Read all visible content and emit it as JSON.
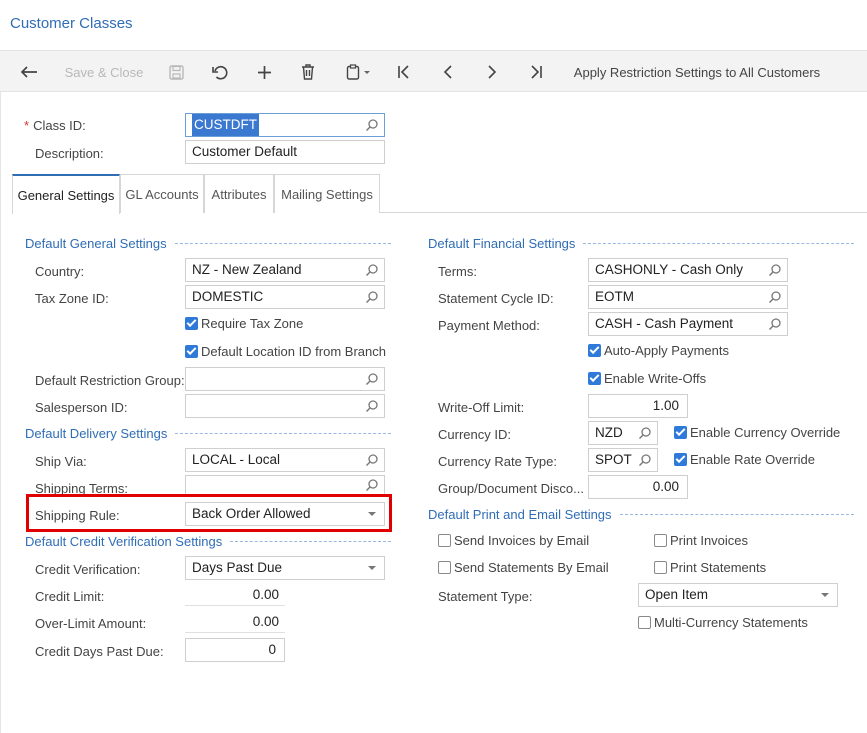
{
  "page": {
    "title": "Customer Classes"
  },
  "toolbar": {
    "save_close": "Save & Close",
    "apply_restriction": "Apply Restriction Settings to All Customers",
    "icons": [
      "back-arrow-icon",
      "save-icon",
      "undo-icon",
      "plus-icon",
      "trash-icon",
      "clipboard-icon",
      "first-icon",
      "prev-icon",
      "next-icon",
      "last-icon"
    ]
  },
  "header": {
    "class_id_label": "Class ID:",
    "class_id_value": "CUSTDFT",
    "description_label": "Description:",
    "description_value": "Customer Default"
  },
  "tabs": [
    {
      "label": "General Settings",
      "active": true
    },
    {
      "label": "GL Accounts"
    },
    {
      "label": "Attributes"
    },
    {
      "label": "Mailing Settings"
    }
  ],
  "general": {
    "section_title": "Default General Settings",
    "country_label": "Country:",
    "country_value": "NZ - New Zealand",
    "tax_zone_label": "Tax Zone ID:",
    "tax_zone_value": "DOMESTIC",
    "require_tax_zone": {
      "label": "Require Tax Zone",
      "checked": true
    },
    "default_location": {
      "label": "Default Location ID from Branch",
      "checked": true
    },
    "restriction_group_label": "Default Restriction Group:",
    "restriction_group_value": "",
    "salesperson_label": "Salesperson ID:",
    "salesperson_value": ""
  },
  "delivery": {
    "section_title": "Default Delivery Settings",
    "ship_via_label": "Ship Via:",
    "ship_via_value": "LOCAL - Local",
    "shipping_terms_label": "Shipping Terms:",
    "shipping_terms_value": "",
    "shipping_rule_label": "Shipping Rule:",
    "shipping_rule_value": "Back Order Allowed"
  },
  "credit": {
    "section_title": "Default Credit Verification Settings",
    "verification_label": "Credit Verification:",
    "verification_value": "Days Past Due",
    "limit_label": "Credit Limit:",
    "limit_value": "0.00",
    "overlimit_label": "Over-Limit Amount:",
    "overlimit_value": "0.00",
    "days_past_due_label": "Credit Days Past Due:",
    "days_past_due_value": "0"
  },
  "financial": {
    "section_title": "Default Financial Settings",
    "terms_label": "Terms:",
    "terms_value": "CASHONLY - Cash Only",
    "statement_cycle_label": "Statement Cycle ID:",
    "statement_cycle_value": "EOTM",
    "payment_method_label": "Payment Method:",
    "payment_method_value": "CASH - Cash Payment",
    "auto_apply": {
      "label": "Auto-Apply Payments",
      "checked": true
    },
    "enable_writeoffs": {
      "label": "Enable Write-Offs",
      "checked": true
    },
    "writeoff_limit_label": "Write-Off Limit:",
    "writeoff_limit_value": "1.00",
    "currency_label": "Currency ID:",
    "currency_value": "NZD",
    "currency_override": {
      "label": "Enable Currency Override",
      "checked": true
    },
    "rate_type_label": "Currency Rate Type:",
    "rate_type_value": "SPOT",
    "rate_override": {
      "label": "Enable Rate Override",
      "checked": true
    },
    "group_discount_label": "Group/Document Disco...",
    "group_discount_value": "0.00"
  },
  "print_email": {
    "section_title": "Default Print and Email Settings",
    "send_invoices": {
      "label": "Send Invoices by Email",
      "checked": false
    },
    "print_invoices": {
      "label": "Print Invoices",
      "checked": false
    },
    "send_statements": {
      "label": "Send Statements By Email",
      "checked": false
    },
    "print_statements": {
      "label": "Print Statements",
      "checked": false
    },
    "statement_type_label": "Statement Type:",
    "statement_type_value": "Open Item",
    "multi_currency": {
      "label": "Multi-Currency Statements",
      "checked": false
    }
  },
  "colors": {
    "accent": "#2f6db5",
    "highlight": "#e00000",
    "check": "#2f7ad8"
  }
}
